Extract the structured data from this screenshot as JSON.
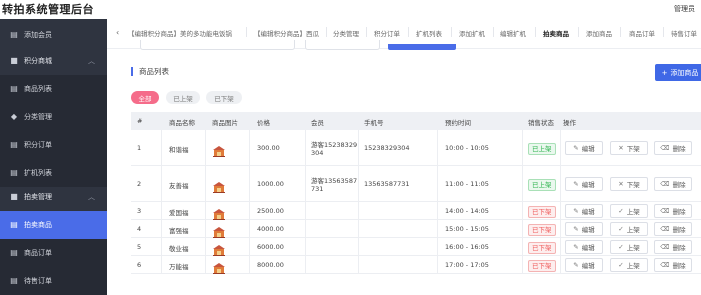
{
  "app": {
    "title": "转拍系统管理后台",
    "user": "管理员"
  },
  "sidebar": {
    "items": [
      {
        "label": "添加会员",
        "icon": "grid-icon"
      },
      {
        "label": "积分商城",
        "icon": "bag-icon",
        "caret": "︿"
      },
      {
        "label": "商品列表",
        "icon": "grid-icon"
      },
      {
        "label": "分类管理",
        "icon": "tag-icon"
      },
      {
        "label": "积分订单",
        "icon": "grid-icon"
      },
      {
        "label": "扩机列表",
        "icon": "grid-icon"
      },
      {
        "label": "拍卖管理",
        "icon": "bag-icon",
        "caret": "︿"
      },
      {
        "label": "拍卖商品",
        "icon": "grid-icon"
      },
      {
        "label": "商品订单",
        "icon": "grid-icon"
      },
      {
        "label": "待售订单",
        "icon": "grid-icon"
      }
    ]
  },
  "tabs": {
    "arrow": "‹",
    "items": [
      {
        "label": "【编辑积分商品】美的多功能电饭锅"
      },
      {
        "label": "【编辑积分商品】西瓜"
      },
      {
        "label": "分类管理"
      },
      {
        "label": "积分订单"
      },
      {
        "label": "扩机列表"
      },
      {
        "label": "添加扩机"
      },
      {
        "label": "编辑扩机"
      },
      {
        "label": "拍卖商品"
      },
      {
        "label": "添加商品"
      },
      {
        "label": "商品订单"
      },
      {
        "label": "待售订单"
      }
    ]
  },
  "section": {
    "title": "商品列表",
    "add_label": "添加商品",
    "add_icon": "+"
  },
  "filters": [
    {
      "label": "全部"
    },
    {
      "label": "已上架"
    },
    {
      "label": "已下架"
    }
  ],
  "table": {
    "headers": [
      "#",
      "商品名称",
      "商品图片",
      "价格",
      "会员",
      "手机号",
      "预约时间",
      "销售状态",
      "操作"
    ],
    "rows": [
      {
        "num": "1",
        "name": "和谐福",
        "price": "300.00",
        "member1": "游客15238329",
        "member2": "304",
        "phone": "15238329304",
        "time": "10:00 - 10:05",
        "status": "已上架",
        "status_kind": "on",
        "ops": [
          "编辑",
          "下架",
          "删除"
        ]
      },
      {
        "num": "2",
        "name": "友善福",
        "price": "1000.00",
        "member1": "游客13563587",
        "member2": "731",
        "phone": "13563587731",
        "time": "11:00 - 11:05",
        "status": "已上架",
        "status_kind": "on",
        "ops": [
          "编辑",
          "下架",
          "删除"
        ]
      },
      {
        "num": "3",
        "name": "爱国福",
        "price": "2500.00",
        "member1": "",
        "member2": "",
        "phone": "",
        "time": "14:00 - 14:05",
        "status": "已下架",
        "status_kind": "off",
        "ops": [
          "编辑",
          "上架",
          "删除"
        ]
      },
      {
        "num": "4",
        "name": "富强福",
        "price": "4000.00",
        "member1": "",
        "member2": "",
        "phone": "",
        "time": "15:00 - 15:05",
        "status": "已下架",
        "status_kind": "off",
        "ops": [
          "编辑",
          "上架",
          "删除"
        ]
      },
      {
        "num": "5",
        "name": "敬业福",
        "price": "6000.00",
        "member1": "",
        "member2": "",
        "phone": "",
        "time": "16:00 - 16:05",
        "status": "已下架",
        "status_kind": "off",
        "ops": [
          "编辑",
          "上架",
          "删除"
        ]
      },
      {
        "num": "6",
        "name": "万能福",
        "price": "8000.00",
        "member1": "",
        "member2": "",
        "phone": "",
        "time": "17:00 - 17:05",
        "status": "已下架",
        "status_kind": "off",
        "ops": [
          "编辑",
          "上架",
          "删除"
        ]
      }
    ],
    "op_icons": [
      "✎",
      "✕",
      "⌫"
    ],
    "op_icons_off": [
      "✎",
      "✓",
      "⌫"
    ]
  },
  "colors": {
    "accent": "#4a6ce8",
    "sidebar": "#2f3440",
    "filter_active": "#f56c8a",
    "status_on": "#2bb24c",
    "status_off": "#ef5a5a"
  }
}
